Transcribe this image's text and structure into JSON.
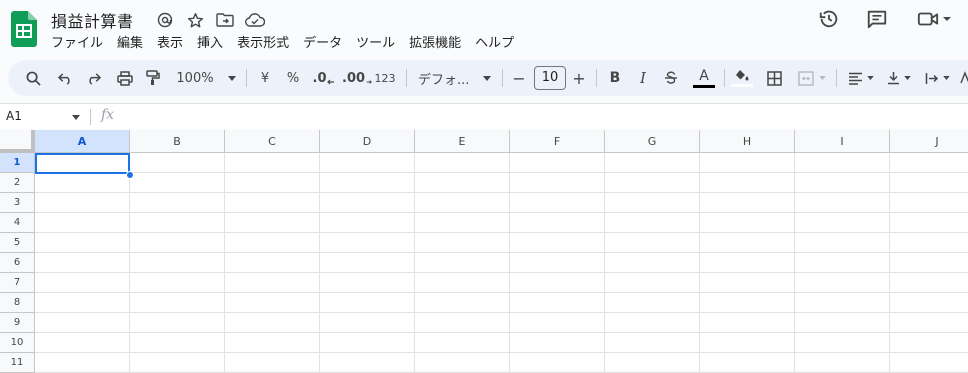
{
  "app": {
    "brand_color": "#0f9d58",
    "accent": "#1a73e8"
  },
  "document": {
    "title": "損益計算書"
  },
  "title_icons": [
    "at-sign-icon",
    "star-icon",
    "move-to-folder-icon",
    "cloud-saved-icon"
  ],
  "menu": [
    "ファイル",
    "編集",
    "表示",
    "挿入",
    "表示形式",
    "データ",
    "ツール",
    "拡張機能",
    "ヘルプ"
  ],
  "top_right": [
    "version-history-icon",
    "comment-icon",
    "meet-camera-icon"
  ],
  "toolbar": {
    "zoom": "100%",
    "currency": "¥",
    "percent": "%",
    "decimal_decrease": ".0",
    "decimal_increase": ".00",
    "more_formats": "123",
    "font": "デフォ...",
    "font_size": "10",
    "minus": "−",
    "plus": "+",
    "bold": "B",
    "italic": "I",
    "text_color": "A"
  },
  "formula_bar": {
    "cell_ref": "A1",
    "fx": "fx"
  },
  "columns": [
    "A",
    "B",
    "C",
    "D",
    "E",
    "F",
    "G",
    "H",
    "I",
    "J"
  ],
  "rows": [
    "1",
    "2",
    "3",
    "4",
    "5",
    "6",
    "7",
    "8",
    "9",
    "10",
    "11"
  ],
  "selected_cell": "A1"
}
